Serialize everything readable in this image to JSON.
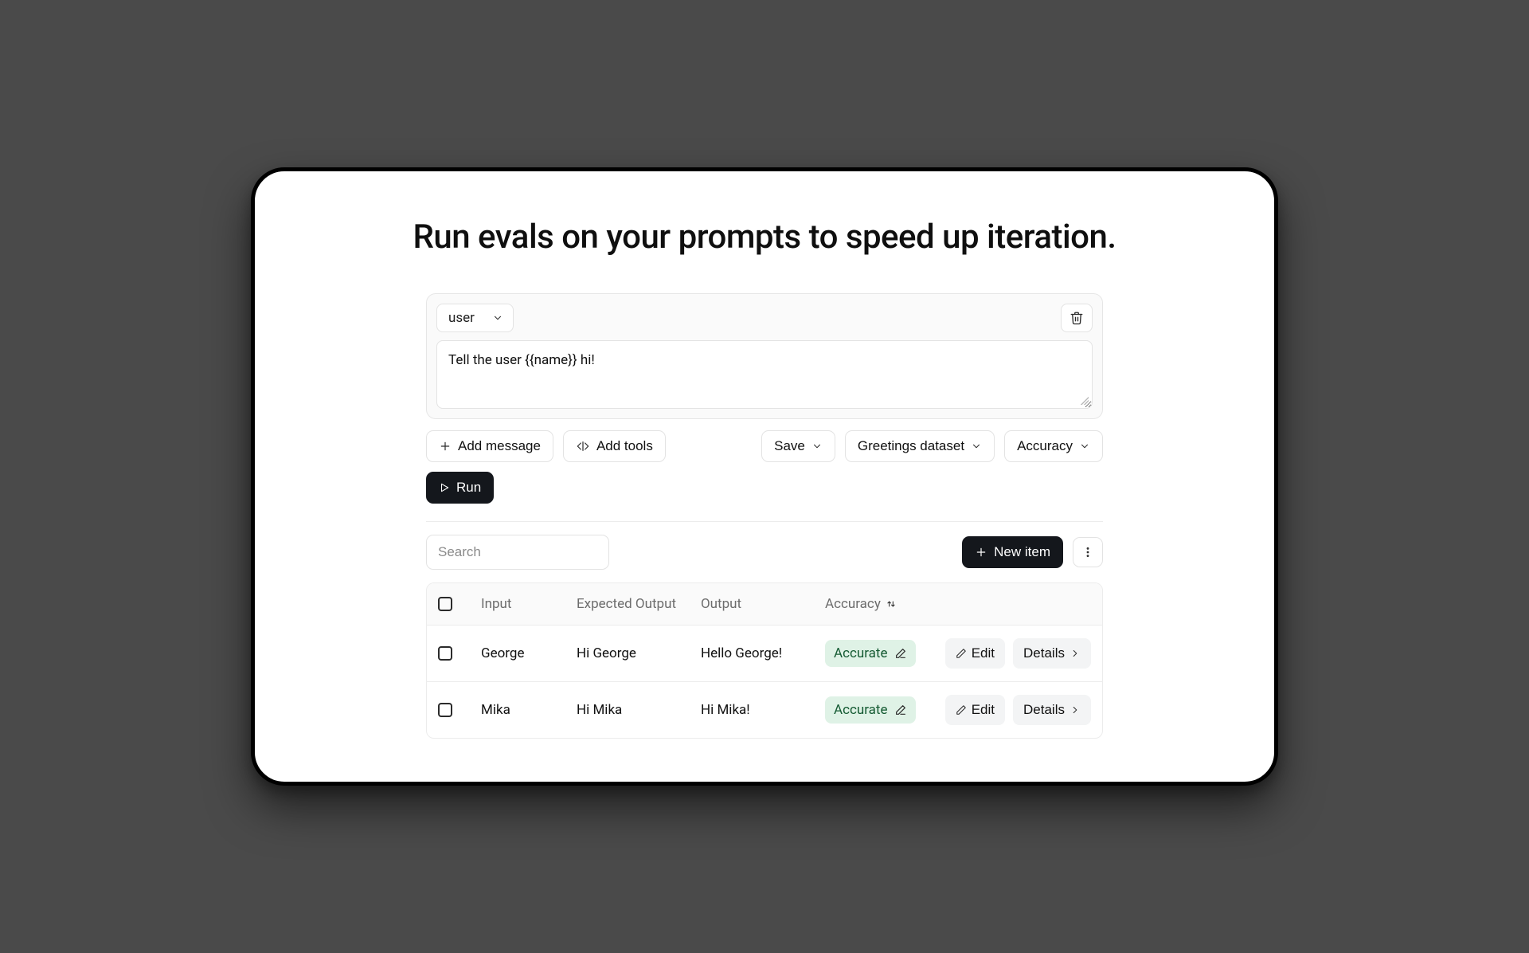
{
  "headline": "Run evals on your prompts to speed up iteration.",
  "prompt": {
    "role": "user",
    "content": "Tell the user {{name}} hi!"
  },
  "toolbar": {
    "add_message": "Add message",
    "add_tools": "Add tools",
    "save": "Save",
    "dataset": "Greetings dataset",
    "metric": "Accuracy",
    "run": "Run"
  },
  "list": {
    "search_placeholder": "Search",
    "new_item": "New item"
  },
  "columns": {
    "input": "Input",
    "expected": "Expected Output",
    "output": "Output",
    "accuracy": "Accuracy"
  },
  "row_actions": {
    "edit": "Edit",
    "details": "Details"
  },
  "accuracy_label": "Accurate",
  "rows": [
    {
      "input": "George",
      "expected": "Hi George",
      "output": "Hello George!",
      "accuracy": "Accurate"
    },
    {
      "input": "Mika",
      "expected": "Hi Mika",
      "output": "Hi Mika!",
      "accuracy": "Accurate"
    }
  ]
}
